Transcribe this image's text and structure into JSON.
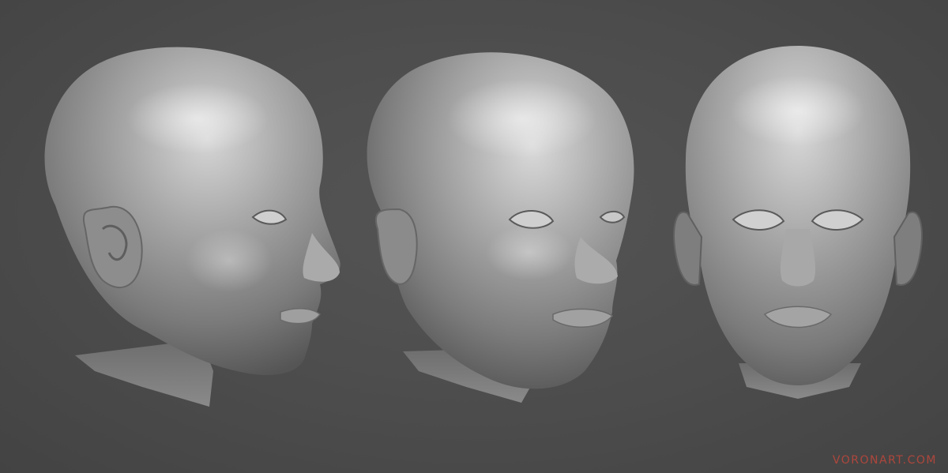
{
  "scene": {
    "background_color": "#4a4a4a",
    "sculpt_color": "#9a9a9a",
    "views": [
      {
        "name": "left-profile-view"
      },
      {
        "name": "three-quarter-view"
      },
      {
        "name": "front-view"
      }
    ]
  },
  "watermark": {
    "text": "VORONART.COM",
    "color": "#c0473b"
  }
}
